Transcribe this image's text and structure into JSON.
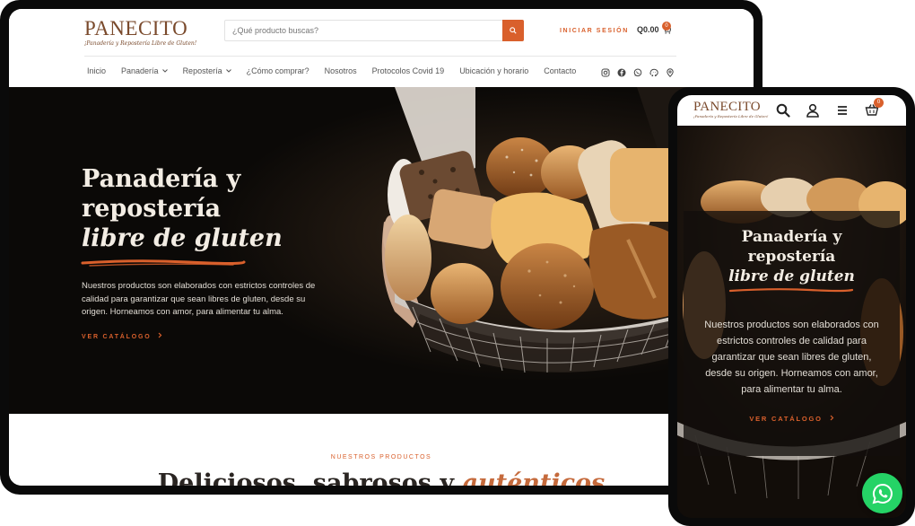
{
  "brand": {
    "name": "PANECITO",
    "tagline": "¡Panadería y Repostería Libre de Gluten!"
  },
  "desktop": {
    "search": {
      "placeholder": "¿Qué producto buscas?"
    },
    "login_label": "INICIAR SESIÓN",
    "cart": {
      "total": "Q0.00",
      "count": "0"
    },
    "nav": [
      {
        "label": "Inicio",
        "dropdown": false
      },
      {
        "label": "Panadería",
        "dropdown": true
      },
      {
        "label": "Repostería",
        "dropdown": true
      },
      {
        "label": "¿Cómo comprar?",
        "dropdown": false
      },
      {
        "label": "Nosotros",
        "dropdown": false
      },
      {
        "label": "Protocolos Covid 19",
        "dropdown": false
      },
      {
        "label": "Ubicación y horario",
        "dropdown": false
      },
      {
        "label": "Contacto",
        "dropdown": false
      }
    ],
    "social_icons": [
      "instagram-icon",
      "facebook-icon",
      "whatsapp-icon",
      "waze-icon",
      "map-pin-icon"
    ],
    "hero": {
      "title_line1": "Panadería y",
      "title_line2": "repostería",
      "title_accent": "libre de gluten",
      "description": "Nuestros productos son elaborados con estrictos controles de calidad para garantizar que sean libres de gluten, desde su origen. Horneamos con amor, para alimentar tu alma.",
      "cta": "VER CATÁLOGO"
    },
    "products_section": {
      "eyebrow": "NUESTROS PRODUCTOS",
      "heading": "Deliciosos, sabrosos y ",
      "heading_accent": "auténticos"
    }
  },
  "mobile": {
    "cart_count": "0",
    "header_icons": [
      "search-icon",
      "user-icon",
      "menu-icon",
      "cart-icon"
    ],
    "hero": {
      "title_line1": "Panadería y",
      "title_line2": "repostería",
      "title_accent": "libre de gluten",
      "description": "Nuestros productos son elaborados con estrictos controles de calidad para garantizar que sean libres de gluten, desde su origen. Horneamos con amor, para alimentar tu alma.",
      "cta": "VER CATÁLOGO"
    }
  },
  "colors": {
    "accent": "#d9602c",
    "brand_brown": "#7a4a2c",
    "hero_bg": "#0b0907",
    "whatsapp": "#25d366"
  }
}
